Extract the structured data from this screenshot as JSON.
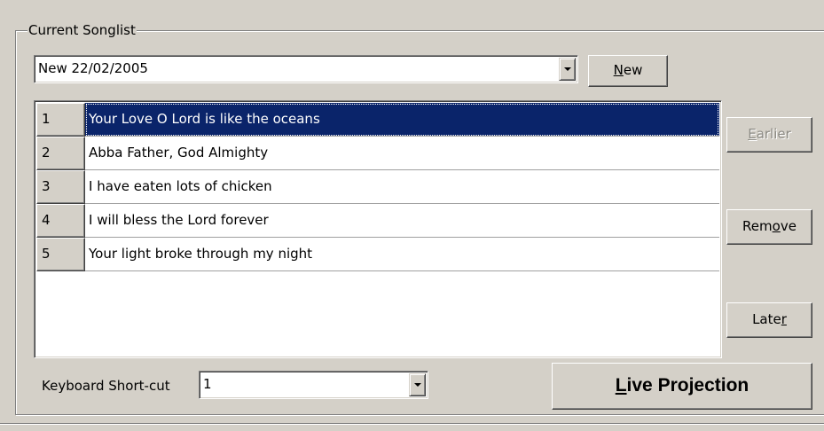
{
  "group": {
    "title": "Current Songlist"
  },
  "songlist_combo": {
    "value": "New 22/02/2005"
  },
  "buttons": {
    "new": {
      "pre": "",
      "accel": "N",
      "post": "ew"
    },
    "earlier": {
      "pre": "",
      "accel": "E",
      "post": "arlier"
    },
    "remove": {
      "pre": "Rem",
      "accel": "o",
      "post": "ve"
    },
    "later": {
      "pre": "Late",
      "accel": "r",
      "post": ""
    },
    "live": {
      "pre": "",
      "accel": "L",
      "post": "ive Projection"
    }
  },
  "songs": [
    {
      "num": "1",
      "title": "Your Love O Lord is like the oceans",
      "selected": true
    },
    {
      "num": "2",
      "title": "Abba Father, God Almighty",
      "selected": false
    },
    {
      "num": "3",
      "title": "I have eaten lots of chicken",
      "selected": false
    },
    {
      "num": "4",
      "title": "I will bless the Lord forever",
      "selected": false
    },
    {
      "num": "5",
      "title": "Your light broke through my night",
      "selected": false
    }
  ],
  "shortcut": {
    "label": "Keyboard Short-cut",
    "value": "1"
  },
  "colors": {
    "selection": "#0a246a",
    "face": "#d4d0c8"
  }
}
